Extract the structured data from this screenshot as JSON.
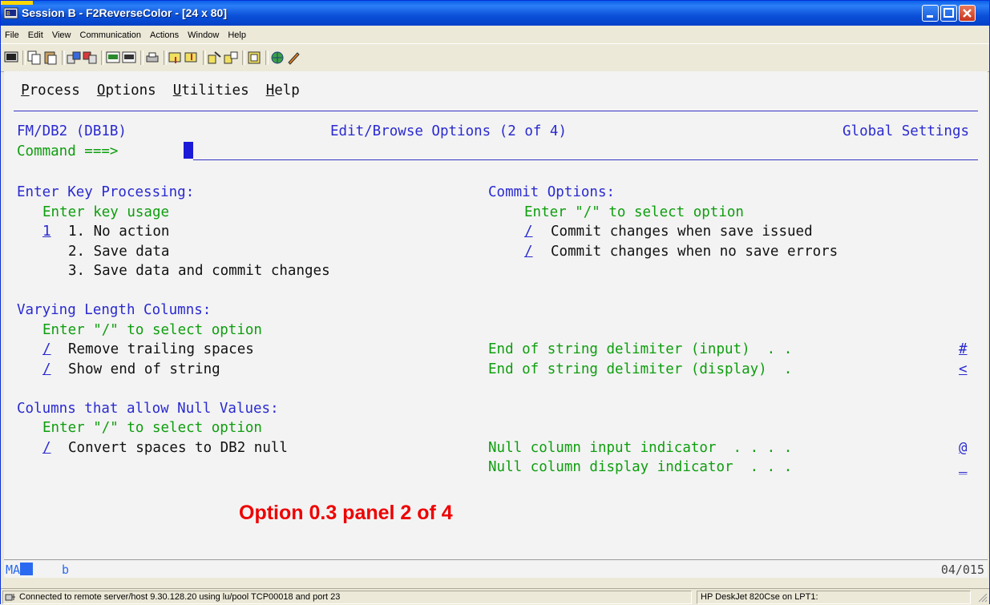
{
  "window": {
    "title": "Session B - F2ReverseColor - [24 x 80]"
  },
  "menubar": [
    "File",
    "Edit",
    "View",
    "Communication",
    "Actions",
    "Window",
    "Help"
  ],
  "toolbar_icons": [
    "display-icon",
    "copy-icon",
    "paste-icon",
    "send-file-icon",
    "receive-file-icon",
    "macro-icon",
    "record-icon",
    "print-screen-icon",
    "upload-icon",
    "download-icon",
    "transfer-icon",
    "transfer-list-icon",
    "clipboard-icon",
    "web-icon",
    "keypad-icon"
  ],
  "terminal": {
    "actions": [
      {
        "key": "P",
        "rest": "rocess"
      },
      {
        "key": "O",
        "rest": "ptions"
      },
      {
        "key": "U",
        "rest": "tilities"
      },
      {
        "key": "H",
        "rest": "elp"
      }
    ],
    "header": {
      "app": "FM/DB2 (DB1B)",
      "panel_title": "Edit/Browse Options (2 of 4)",
      "scope": "Global Settings",
      "command_label": "Command ===> "
    },
    "enter_key": {
      "heading": "Enter Key Processing:",
      "sub": "Enter key usage",
      "value": "1",
      "options": [
        "1. No action",
        "2. Save data",
        "3. Save data and commit changes"
      ]
    },
    "commit": {
      "heading": "Commit Options:",
      "sub": "Enter \"/\" to select option",
      "items": [
        {
          "mark": "/",
          "label": "Commit changes when save issued"
        },
        {
          "mark": "/",
          "label": "Commit changes when no save errors"
        }
      ]
    },
    "varying": {
      "heading": "Varying Length Columns:",
      "sub": "Enter \"/\" to select option",
      "items": [
        {
          "mark": "/",
          "label": "Remove trailing spaces"
        },
        {
          "mark": "/",
          "label": "Show end of string"
        }
      ],
      "delims": [
        {
          "label": "End of string delimiter (input)  . . ",
          "value": "#"
        },
        {
          "label": "End of string delimiter (display)  . ",
          "value": "<"
        }
      ]
    },
    "nulls": {
      "heading": "Columns that allow Null Values:",
      "sub": "Enter \"/\" to select option",
      "item": {
        "mark": "/",
        "label": "Convert spaces to DB2 null"
      },
      "indicators": [
        {
          "label": "Null column input indicator  . . . . ",
          "value": "@"
        },
        {
          "label": "Null column display indicator  . . . ",
          "value": "_"
        }
      ]
    }
  },
  "overlay_caption": "Option 0.3 panel 2 of 4",
  "oia": {
    "mode": "MA",
    "session": "b",
    "cursor_pos": "04/015"
  },
  "statusbar": {
    "connection": "Connected to remote server/host 9.30.128.20 using lu/pool TCP00018 and port 23",
    "printer": "HP DeskJet 820Cse on LPT1:"
  }
}
